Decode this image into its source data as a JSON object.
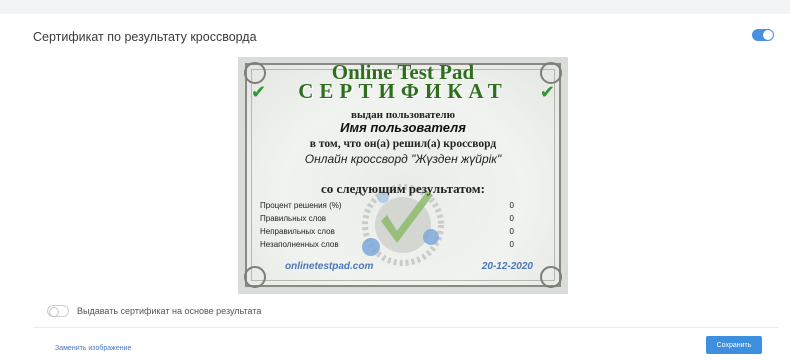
{
  "section": {
    "title": "Сертификат по результату кроссворда",
    "enabled": true
  },
  "certificate": {
    "brand": "Online Test Pad",
    "heading": "СЕРТИФИКАТ",
    "issued_to_label": "выдан пользователю",
    "user_name": "Имя пользователя",
    "solved_label": "в том, что он(а) решил(а) кроссворд",
    "crossword_name": "Онлайн кроссворд \"Жүзден жүйрік\"",
    "result_label": "со следующим результатом:",
    "results": [
      {
        "label": "Процент решения (%)",
        "value": "0"
      },
      {
        "label": "Правильных слов",
        "value": "0"
      },
      {
        "label": "Неправильных слов",
        "value": "0"
      },
      {
        "label": "Незаполненных слов",
        "value": "0"
      }
    ],
    "site": "onlinetestpad.com",
    "date": "20-12-2020"
  },
  "issue_by_result": {
    "label": "Выдавать сертификат на основе результата",
    "enabled": false
  },
  "footer": {
    "replace_image": "Заменить изображение",
    "save": "Сохранить"
  },
  "colors": {
    "accent": "#3d8fe0",
    "cert_title": "#2f6d1f",
    "cert_link": "#4a78b8"
  }
}
